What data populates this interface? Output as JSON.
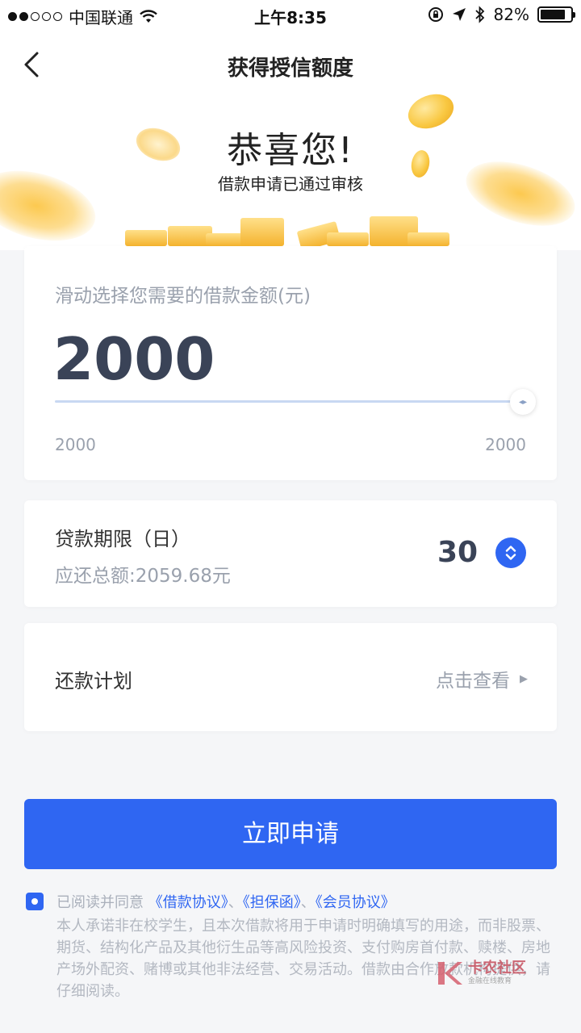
{
  "status_bar": {
    "carrier": "中国联通",
    "time": "上午8:35",
    "battery_percent": "82%",
    "battery_level": 0.82,
    "signal_bars_filled": 2,
    "signal_bars_total": 5
  },
  "nav": {
    "title": "获得授信额度",
    "back_icon": "chevron-left-icon"
  },
  "hero": {
    "title": "恭喜您!",
    "subtitle": "借款申请已通过审核"
  },
  "amount_card": {
    "label": "滑动选择您需要的借款金额(元)",
    "value": "2000",
    "min_label": "2000",
    "max_label": "2000",
    "slider_fraction": 1.0
  },
  "term_card": {
    "label": "贷款期限（日）",
    "total_repayment": "应还总额:2059.68元",
    "value": "30",
    "picker_icon": "up-down-chevron-icon"
  },
  "plan_card": {
    "label": "还款计划",
    "link_text": "点击查看",
    "arrow_icon": "triangle-right-icon"
  },
  "apply_button": {
    "label": "立即申请"
  },
  "agreement": {
    "prefix": "已阅读并同意",
    "links": [
      "《借款协议》",
      "《担保函》",
      "《会员协议》"
    ],
    "separator": "、",
    "checked": true,
    "disclaimer": "本人承诺非在校学生，且本次借款将用于申请时明确填写的用途，而非股票、期货、结构化产品及其他衍生品等高风险投资、支付购房首付款、赎楼、房地产场外配资、赌博或其他非法经营、交易活动。借款由合作放款机构提供，请仔细阅读。"
  },
  "watermark": {
    "title": "卡农社区",
    "subtitle": "金融在线教育"
  },
  "colors": {
    "primary": "#2f66f2",
    "background": "#f5f6f8",
    "muted_text": "#9aa1ad",
    "value_text": "#3a4357",
    "coin_gold": "#f9c842"
  }
}
